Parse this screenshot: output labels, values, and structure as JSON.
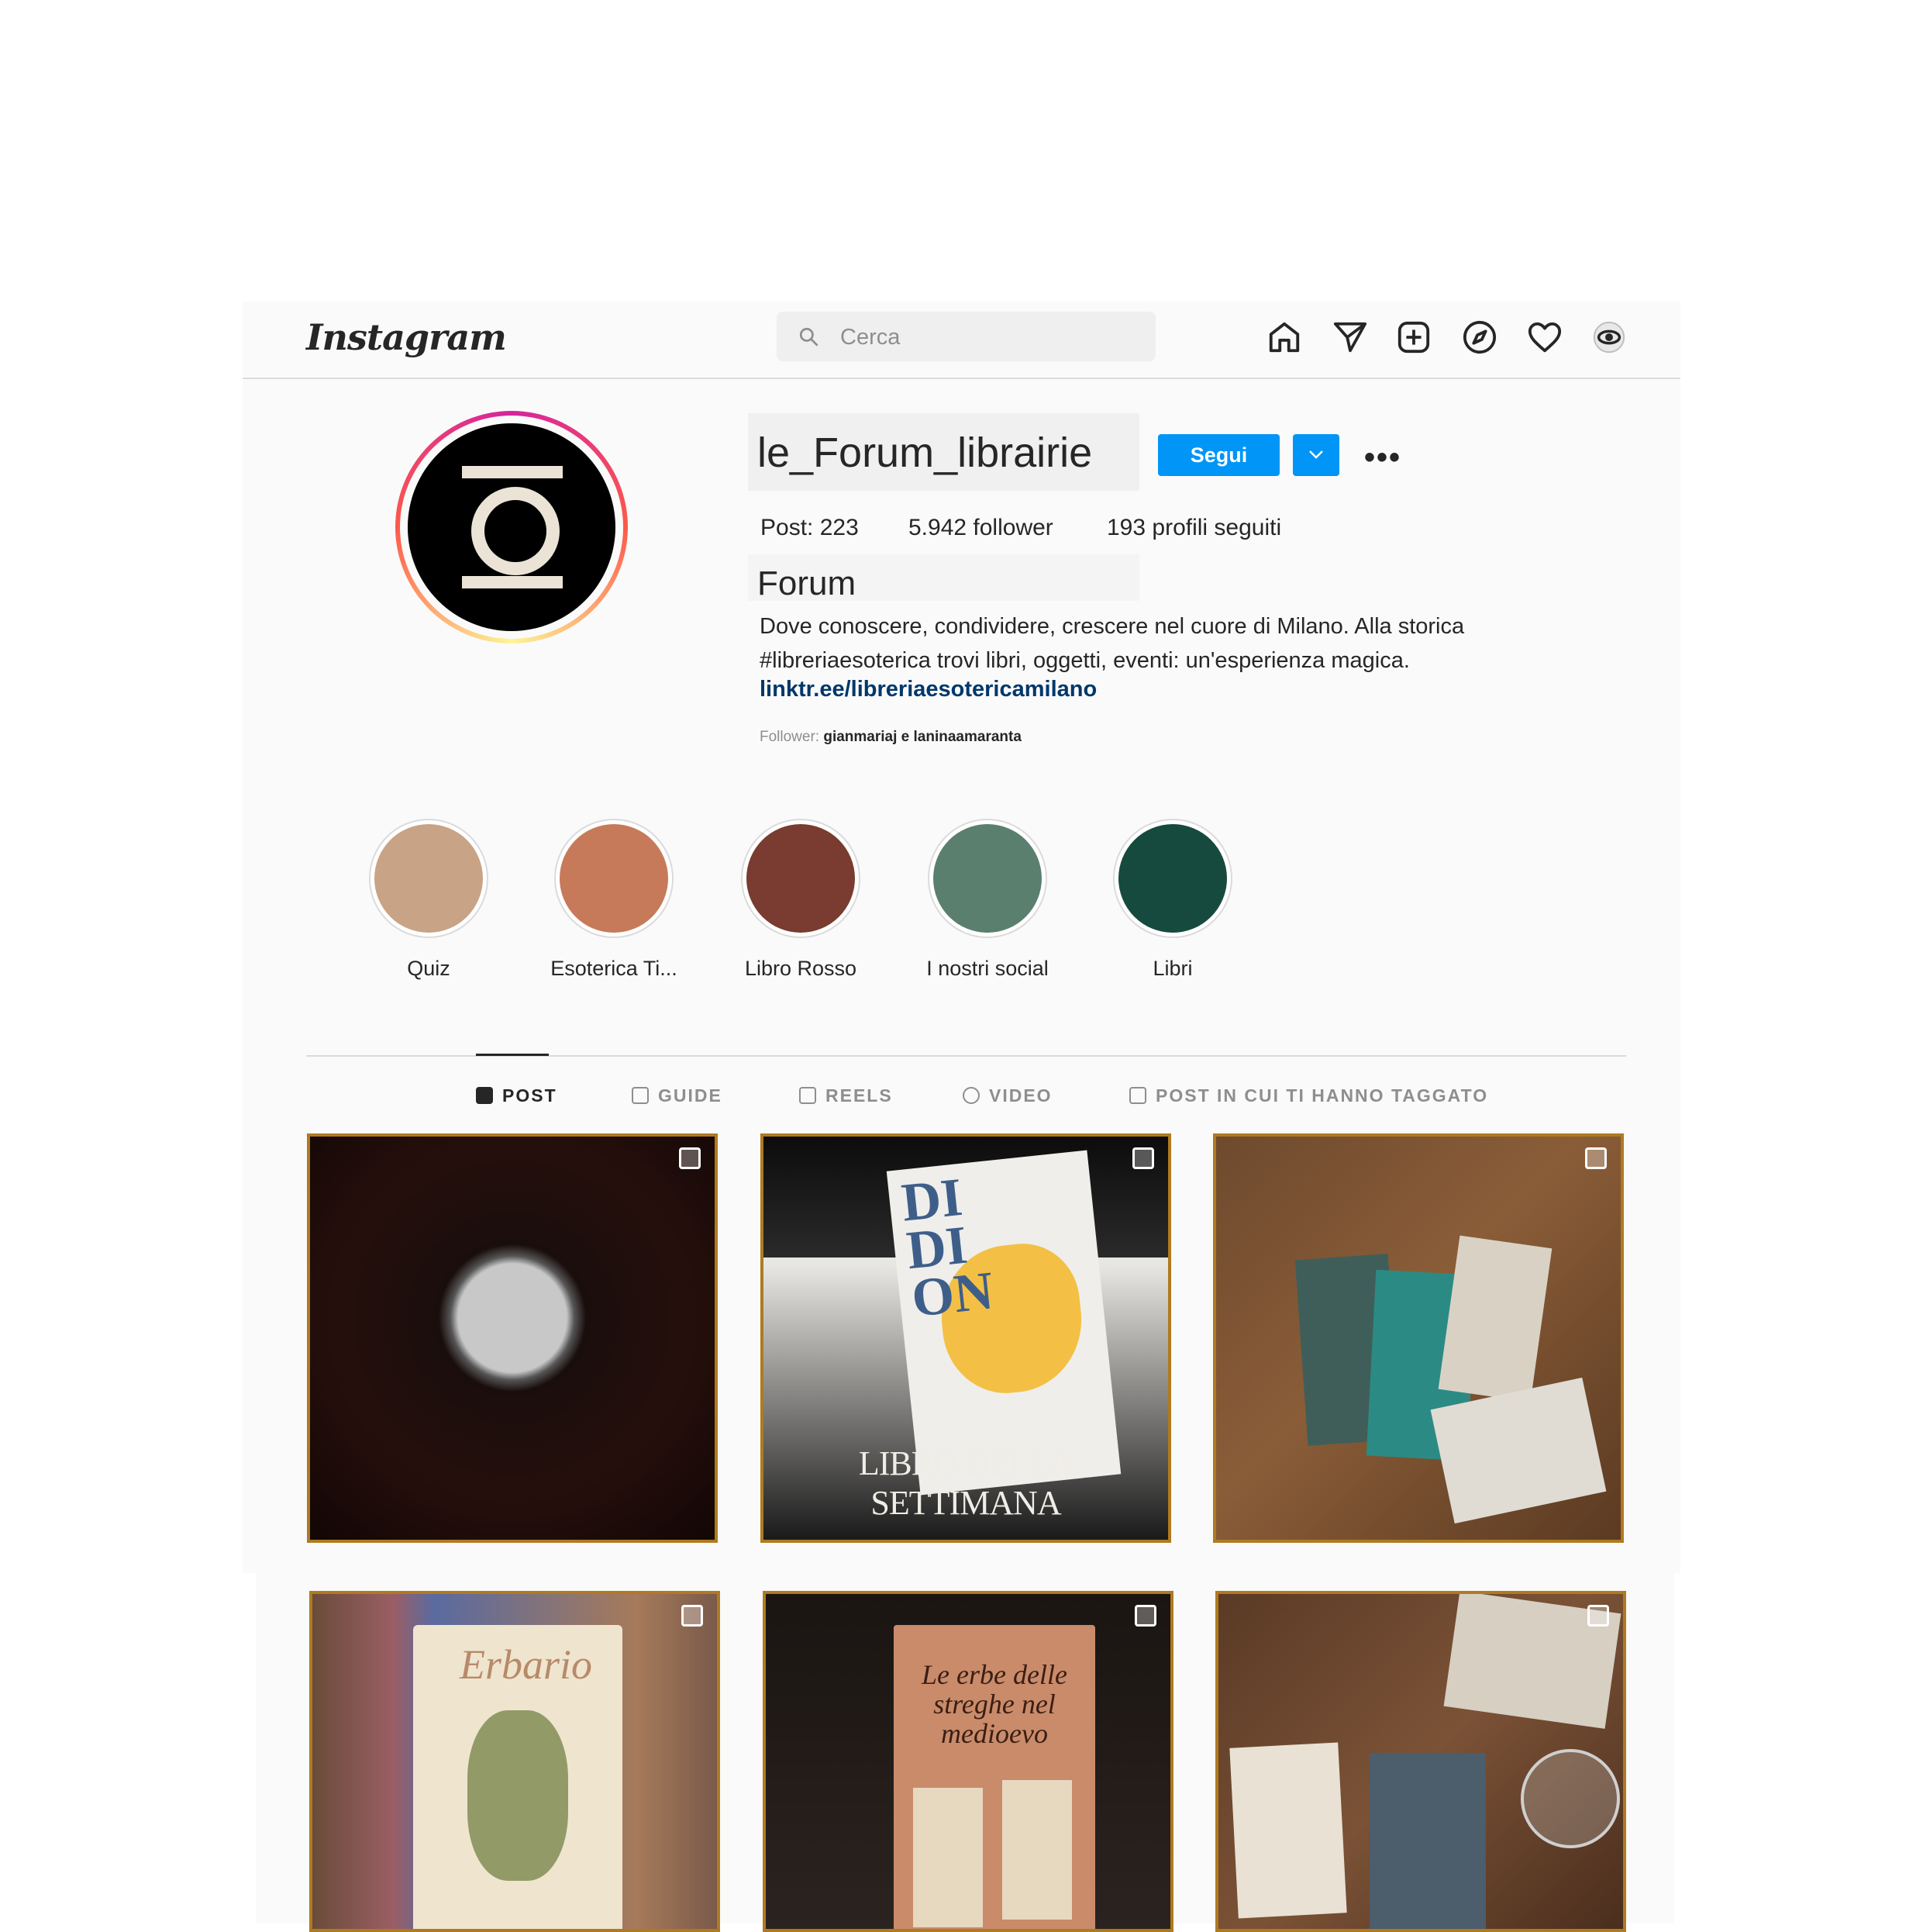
{
  "nav": {
    "logo": "Instagram",
    "search_placeholder": "Cerca",
    "icons": [
      "home-icon",
      "direct-icon",
      "new-post-icon",
      "explore-icon",
      "activity-icon",
      "profile-icon"
    ]
  },
  "profile": {
    "username": "le_Forum_librairie",
    "follow_label": "Segui",
    "more_label": "•••",
    "stats": {
      "posts": "Post: 223",
      "followers": "5.942 follower",
      "following": "193 profili seguiti"
    },
    "full_name": "Forum",
    "bio_line1": "Dove conoscere, condividere, crescere nel cuore di Milano. Alla storica",
    "bio_line2": "#libreriaesoterica trovi libri, oggetti, eventi: un'esperienza magica.",
    "link": "linktr.ee/libreriaesotericamilano",
    "followed_by_prefix": "Follower: ",
    "followed_by_names": "gianmariaj e laninaamaranta"
  },
  "highlights": [
    {
      "label": "Quiz",
      "color": "#c9a386"
    },
    {
      "label": "Esoterica Ti...",
      "color": "#c77a5a"
    },
    {
      "label": "Libro Rosso",
      "color": "#7a3b30"
    },
    {
      "label": "I nostri social",
      "color": "#5a7f6e"
    },
    {
      "label": "Libri",
      "color": "#174a3e"
    }
  ],
  "tabs": [
    {
      "label": "POST",
      "active": true
    },
    {
      "label": "GUIDE",
      "active": false
    },
    {
      "label": "REELS",
      "active": false
    },
    {
      "label": "VIDEO",
      "active": false
    },
    {
      "label": "POST IN CUI TI HANNO TAGGATO",
      "active": false
    }
  ],
  "posts": [
    {
      "caption": ""
    },
    {
      "caption": "LIBRO DELLA SETTIMANA"
    },
    {
      "caption": ""
    },
    {
      "caption": ""
    },
    {
      "caption": ""
    },
    {
      "caption": ""
    }
  ],
  "colors": {
    "accent": "#0095f6",
    "link": "#00376b",
    "post_border": "#b07a20"
  }
}
